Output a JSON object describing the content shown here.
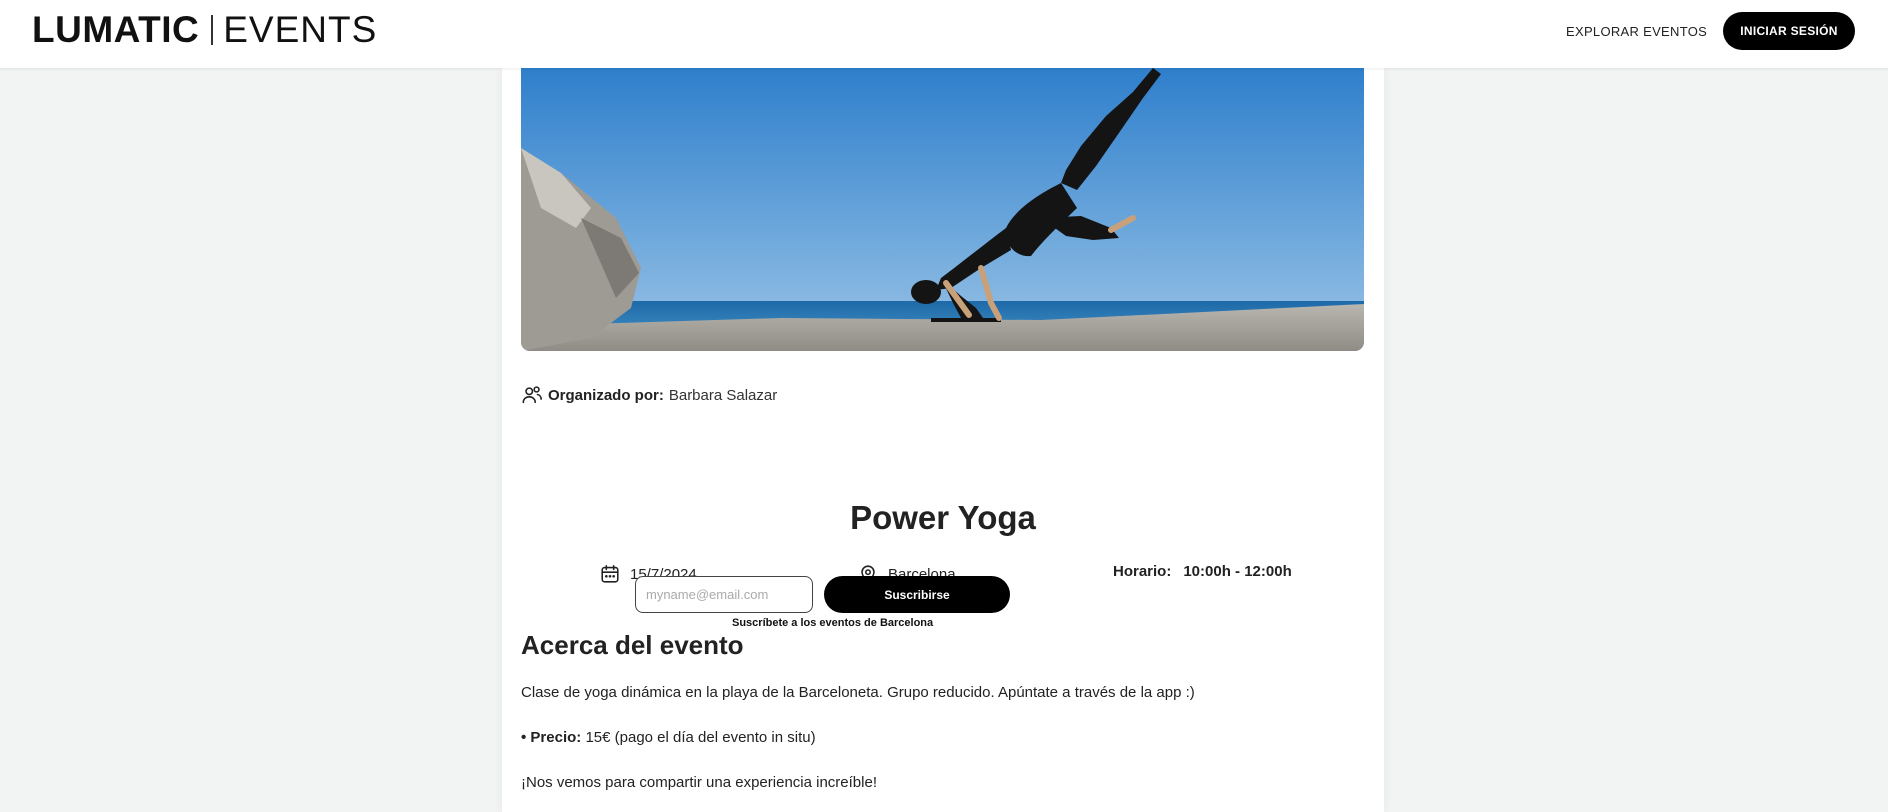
{
  "header": {
    "logo_bold": "LUMATIC",
    "logo_light": "EVENTS",
    "nav_explore": "EXPLORAR EVENTOS",
    "login_button": "INICIAR SESIÓN"
  },
  "event": {
    "organizer_label": "Organizado por:",
    "organizer_name": "Barbara Salazar",
    "title": "Power Yoga",
    "date": "15/7/2024",
    "location": "Barcelona",
    "time_label": "Horario:",
    "time_value": "10:00h - 12:00h"
  },
  "subscribe": {
    "label": "Suscríbete a los eventos de Barcelona",
    "placeholder": "myname@email.com",
    "button": "Suscribirse"
  },
  "about": {
    "heading": "Acerca del evento",
    "description": "Clase de yoga dinámica en la playa de la Barceloneta. Grupo reducido. Apúntate a través de la app :)",
    "price_prefix": "• Precio:",
    "price_value": "15€ (pago el día del evento in situ)",
    "closing": "¡Nos vemos para compartir una experiencia increíble!"
  },
  "colors": {
    "page_background": "#f1f4f3",
    "button_background": "#000000",
    "button_text": "#ffffff"
  },
  "icons": {
    "organizer": "users-icon",
    "date": "calendar-icon",
    "location": "map-pin-icon"
  }
}
